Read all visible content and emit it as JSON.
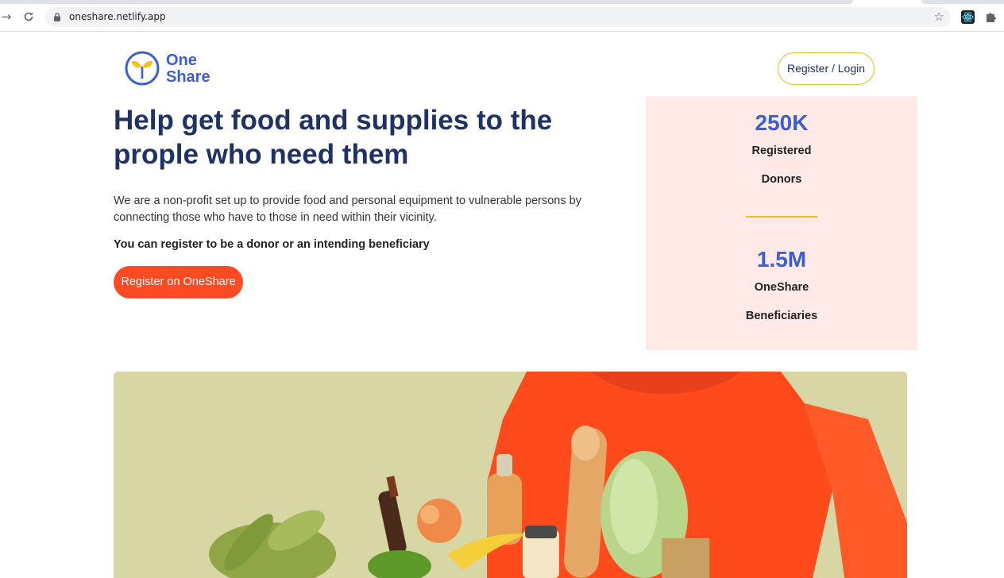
{
  "browser": {
    "url": "oneshare.netlify.app",
    "back_icon": "arrow-right-icon",
    "reload_icon": "reload-icon"
  },
  "header": {
    "logo_line1": "One",
    "logo_line2": "Share",
    "login_label": "Register / Login"
  },
  "hero": {
    "title": "Help get food and supplies to the prople who need them",
    "description": "We are a non-profit set up to provide food and personal equipment to vulnerable persons by connecting those who have to those in need within their vicinity.",
    "note": "You can register to be a donor or an intending beneficiary",
    "cta_label": "Register on OneShare"
  },
  "stats": [
    {
      "value": "250K",
      "label1": "Registered",
      "label2": "Donors"
    },
    {
      "value": "1.5M",
      "label1": "OneShare",
      "label2": "Beneficiaries"
    }
  ],
  "colors": {
    "brand_blue": "#3c5fd0",
    "title_navy": "#1f3264",
    "cta_orange": "#ff4b24",
    "accent_yellow": "#e6c02b",
    "stats_bg": "#ffeae7"
  }
}
